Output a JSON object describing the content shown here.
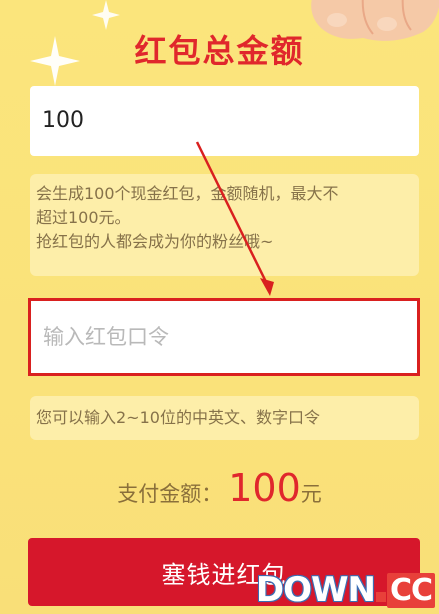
{
  "header": {
    "title": "红包总金额"
  },
  "amount": {
    "value": "100"
  },
  "amount_hint": {
    "line1": "会生成100个现金红包，金额随机，最大不",
    "line2": "超过100元。",
    "line3": "抢红包的人都会成为你的粉丝哦~"
  },
  "password": {
    "placeholder": "输入红包口令",
    "value": ""
  },
  "password_hint": {
    "text": "您可以输入2~10位的中英文、数字口令"
  },
  "payment": {
    "label": "支付金额：",
    "amount": "100",
    "unit": "元"
  },
  "submit": {
    "label": "塞钱进红包"
  },
  "watermark": {
    "part1": "DOWN",
    "part2": "CC"
  },
  "colors": {
    "background": "#fbe27a",
    "accent_red": "#e0272c",
    "button_red": "#d6172b",
    "hint_bg": "#fdeea9"
  }
}
